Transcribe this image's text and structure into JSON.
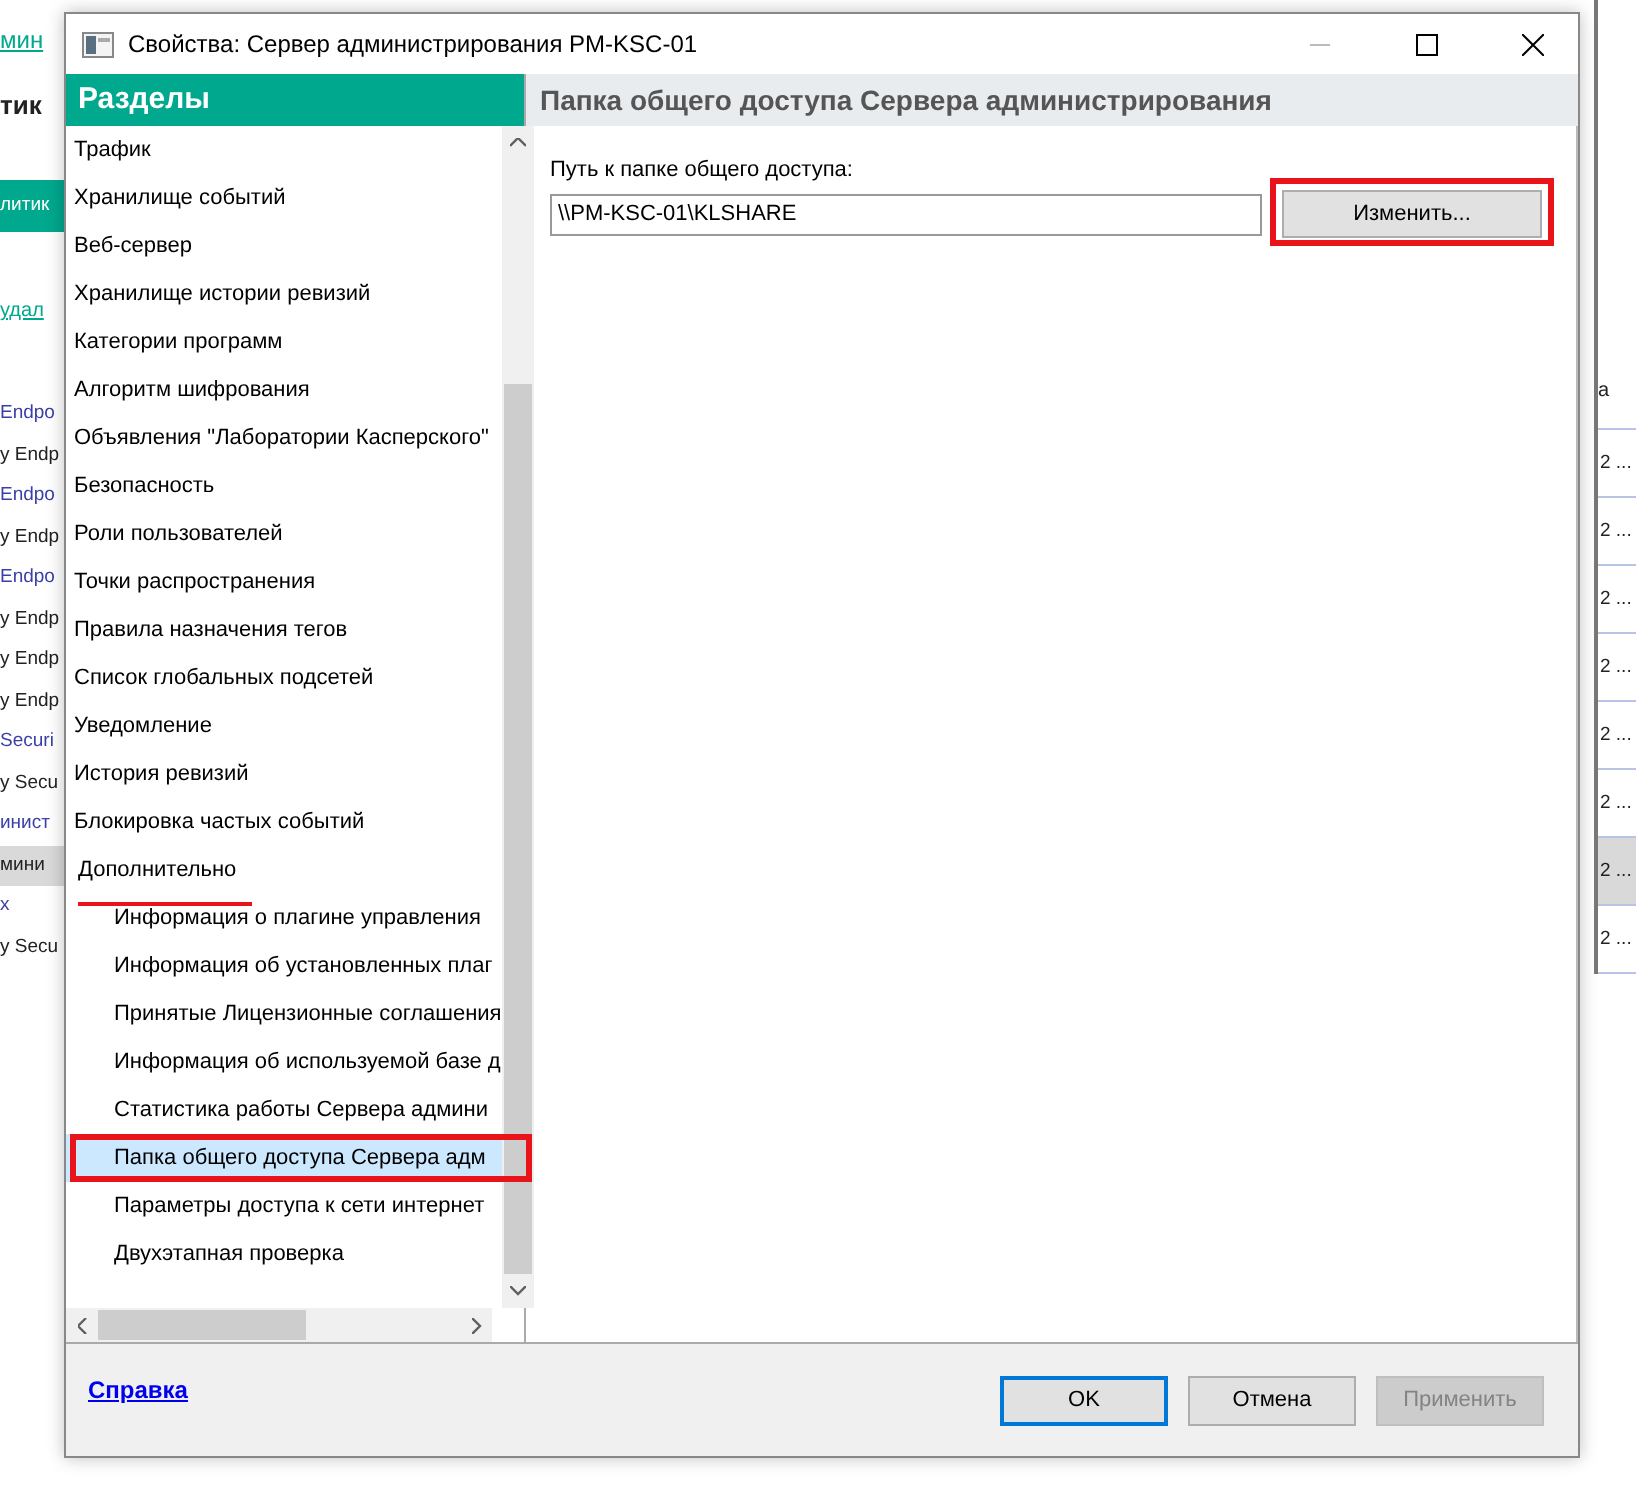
{
  "background": {
    "left": [
      {
        "kind": "link",
        "text": "мин",
        "selected": false
      },
      {
        "kind": "heading",
        "text": "тик",
        "selected": false
      },
      {
        "kind": "button",
        "text": "литик",
        "selected": false
      },
      {
        "kind": "link",
        "text": "удал",
        "selected": false
      },
      {
        "kind": "group",
        "text": "Endpo",
        "selected": false
      },
      {
        "kind": "row",
        "text": "y Endp",
        "selected": false
      },
      {
        "kind": "group",
        "text": "Endpo",
        "selected": false
      },
      {
        "kind": "row",
        "text": "y Endp",
        "selected": false
      },
      {
        "kind": "group",
        "text": "Endpo",
        "selected": false
      },
      {
        "kind": "row",
        "text": "y Endp",
        "selected": false
      },
      {
        "kind": "row",
        "text": "y Endp",
        "selected": false
      },
      {
        "kind": "row",
        "text": "y Endp",
        "selected": false
      },
      {
        "kind": "group",
        "text": "Securi",
        "selected": false
      },
      {
        "kind": "row",
        "text": "y Secu",
        "selected": false
      },
      {
        "kind": "group",
        "text": "инист",
        "selected": false
      },
      {
        "kind": "row",
        "text": "мини",
        "selected": true
      },
      {
        "kind": "group",
        "text": "x",
        "selected": false
      },
      {
        "kind": "row",
        "text": "y Secu",
        "selected": false
      }
    ],
    "right": [
      {
        "kind": "heading",
        "text": "а",
        "selected": false
      },
      {
        "kind": "row",
        "text": "2 ...",
        "selected": false
      },
      {
        "kind": "row",
        "text": "2 ...",
        "selected": false
      },
      {
        "kind": "row",
        "text": "2 ...",
        "selected": false
      },
      {
        "kind": "row",
        "text": "2 ...",
        "selected": false
      },
      {
        "kind": "row",
        "text": "2 ...",
        "selected": false
      },
      {
        "kind": "row",
        "text": "2 ...",
        "selected": false
      },
      {
        "kind": "row",
        "text": "2 ...",
        "selected": true
      },
      {
        "kind": "row",
        "text": "2 ...",
        "selected": false
      }
    ]
  },
  "window": {
    "title": "Свойства: Сервер администрирования PM-KSC-01",
    "minimize_disabled": true
  },
  "sidebar": {
    "title": "Разделы",
    "items": [
      {
        "label": "Трафик",
        "selected": false
      },
      {
        "label": "Хранилище событий",
        "selected": false
      },
      {
        "label": "Веб-сервер",
        "selected": false
      },
      {
        "label": "Хранилище истории ревизий",
        "selected": false
      },
      {
        "label": "Категории программ",
        "selected": false
      },
      {
        "label": "Алгоритм шифрования",
        "selected": false
      },
      {
        "label": "Объявления \"Лаборатории Касперского\"",
        "selected": false
      },
      {
        "label": "Безопасность",
        "selected": false
      },
      {
        "label": "Роли пользователей",
        "selected": false
      },
      {
        "label": "Точки распространения",
        "selected": false
      },
      {
        "label": "Правила назначения тегов",
        "selected": false
      },
      {
        "label": "Список глобальных подсетей",
        "selected": false
      },
      {
        "label": "Уведомление",
        "selected": false
      },
      {
        "label": "История ревизий",
        "selected": false
      },
      {
        "label": "Блокировка частых событий",
        "selected": false
      },
      {
        "label": "Дополнительно",
        "selected": false,
        "underlined": true,
        "children": [
          {
            "label": "Информация о плагине управления",
            "selected": false
          },
          {
            "label": "Информация об установленных плаг",
            "selected": false
          },
          {
            "label": "Принятые Лицензионные соглашения",
            "selected": false
          },
          {
            "label": "Информация об используемой базе д",
            "selected": false
          },
          {
            "label": "Статистика работы Сервера админи",
            "selected": false
          },
          {
            "label": "Папка общего доступа Сервера адм",
            "selected": true,
            "boxed": true
          },
          {
            "label": "Параметры доступа к сети интернет",
            "selected": false
          },
          {
            "label": "Двухэтапная проверка",
            "selected": false
          }
        ]
      }
    ]
  },
  "panel": {
    "title": "Папка общего доступа Сервера администрирования",
    "field_label": "Путь к папке общего доступа:",
    "field_value": "\\\\PM-KSC-01\\KLSHARE",
    "button": {
      "label": "Изменить...",
      "boxed": true
    }
  },
  "footer": {
    "help_link": "Справка",
    "buttons": [
      {
        "label": "OK",
        "default": true,
        "disabled": false
      },
      {
        "label": "Отмена",
        "default": false,
        "disabled": false
      },
      {
        "label": "Применить",
        "default": false,
        "disabled": true
      }
    ]
  }
}
